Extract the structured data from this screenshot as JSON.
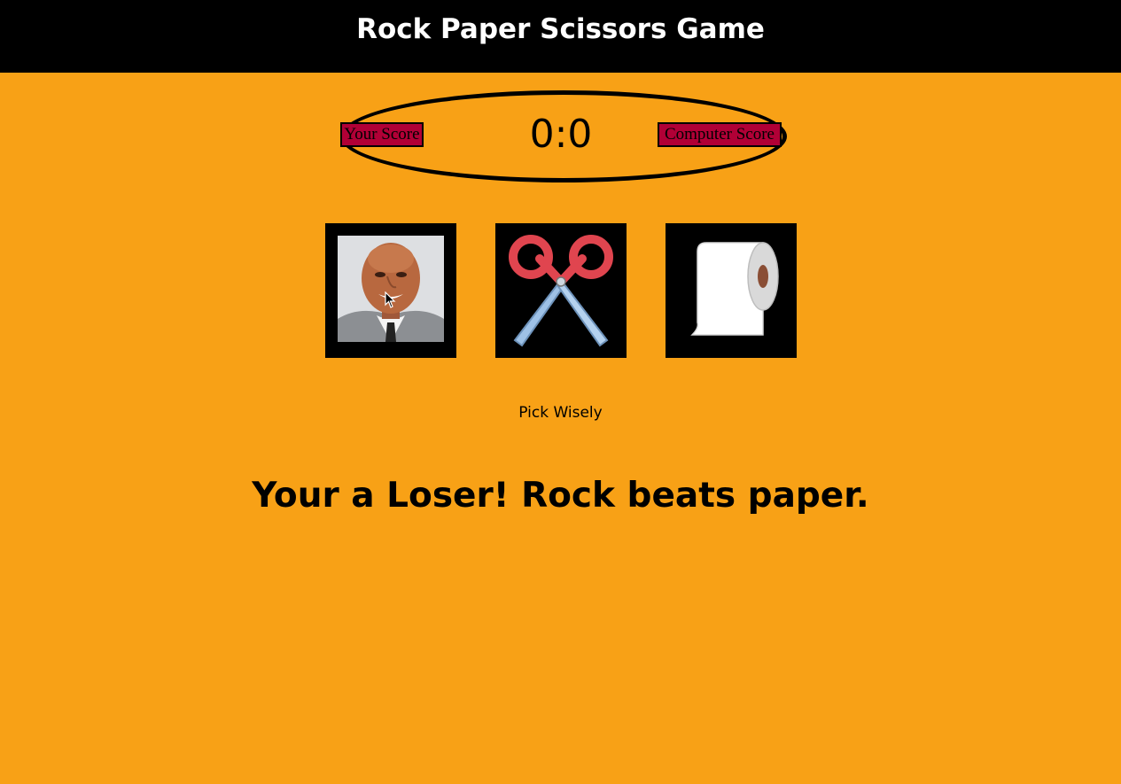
{
  "header": {
    "title": "Rock Paper Scissors Game"
  },
  "scoreboard": {
    "user_label": "Your Score",
    "computer_label": "Computer Score",
    "score": "0:0",
    "user_score": 0,
    "computer_score": 0
  },
  "choices": [
    {
      "name": "rock",
      "icon": "rock-face-image"
    },
    {
      "name": "scissors",
      "icon": "scissors-icon"
    },
    {
      "name": "paper",
      "icon": "toilet-paper-icon"
    }
  ],
  "prompt": "Pick Wisely",
  "result": "Your a Loser! Rock beats paper.",
  "colors": {
    "background": "#f8a116",
    "header": "#000000",
    "badge": "#b10036",
    "choice_tile": "#000000"
  }
}
